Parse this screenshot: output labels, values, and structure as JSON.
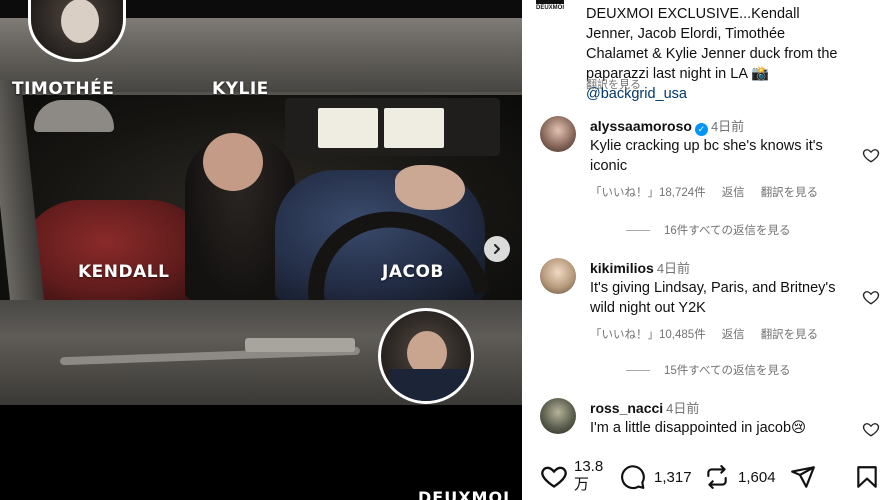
{
  "media": {
    "labels": {
      "timothee": "TIMOTHÉE",
      "kylie": "KYLIE",
      "kendall": "KENDALL",
      "jacob": "JACOB"
    },
    "watermark": "DEUXMOI",
    "next_icon": "chevron-right-icon"
  },
  "post": {
    "account_logo": "DEUXMOI",
    "caption_main": "DEUXMOI EXCLUSIVE...Kendall Jenner, Jacob Elordi, Timothée Chalamet & Kylie Jenner duck from the paparazzi last night in LA 📸",
    "caption_link": "@backgrid_usa",
    "translate": "翻訳を見る"
  },
  "comments": [
    {
      "user": "alyssaamoroso",
      "verified": true,
      "time": "4日前",
      "text": "Kylie cracking up bc she's knows it's iconic",
      "likes": "「いいね！」18,724件",
      "reply": "返信",
      "translate": "翻訳を見る",
      "view_replies": "16件すべての返信を見る",
      "avatar_color": "#8a6a5c"
    },
    {
      "user": "kikimilios",
      "verified": false,
      "time": "4日前",
      "text": "It's giving Lindsay, Paris, and Britney's wild night out Y2K",
      "likes": "「いいね！」10,485件",
      "reply": "返信",
      "translate": "翻訳を見る",
      "view_replies": "15件すべての返信を見る",
      "avatar_color": "#b69a7c"
    },
    {
      "user": "ross_nacci",
      "verified": false,
      "time": "4日前",
      "text": "I'm a little disappointed in jacob😢",
      "avatar_color": "#5b5f4e"
    }
  ],
  "actions": {
    "likes_count": "13.8",
    "likes_unit": "万",
    "comments_count": "1,317",
    "reposts_count": "1,604",
    "icons": [
      "heart-icon",
      "comment-icon",
      "repost-icon",
      "share-icon",
      "bookmark-icon"
    ]
  },
  "colors": {
    "link": "#00376b",
    "muted": "#737373",
    "verified": "#0095f6"
  }
}
